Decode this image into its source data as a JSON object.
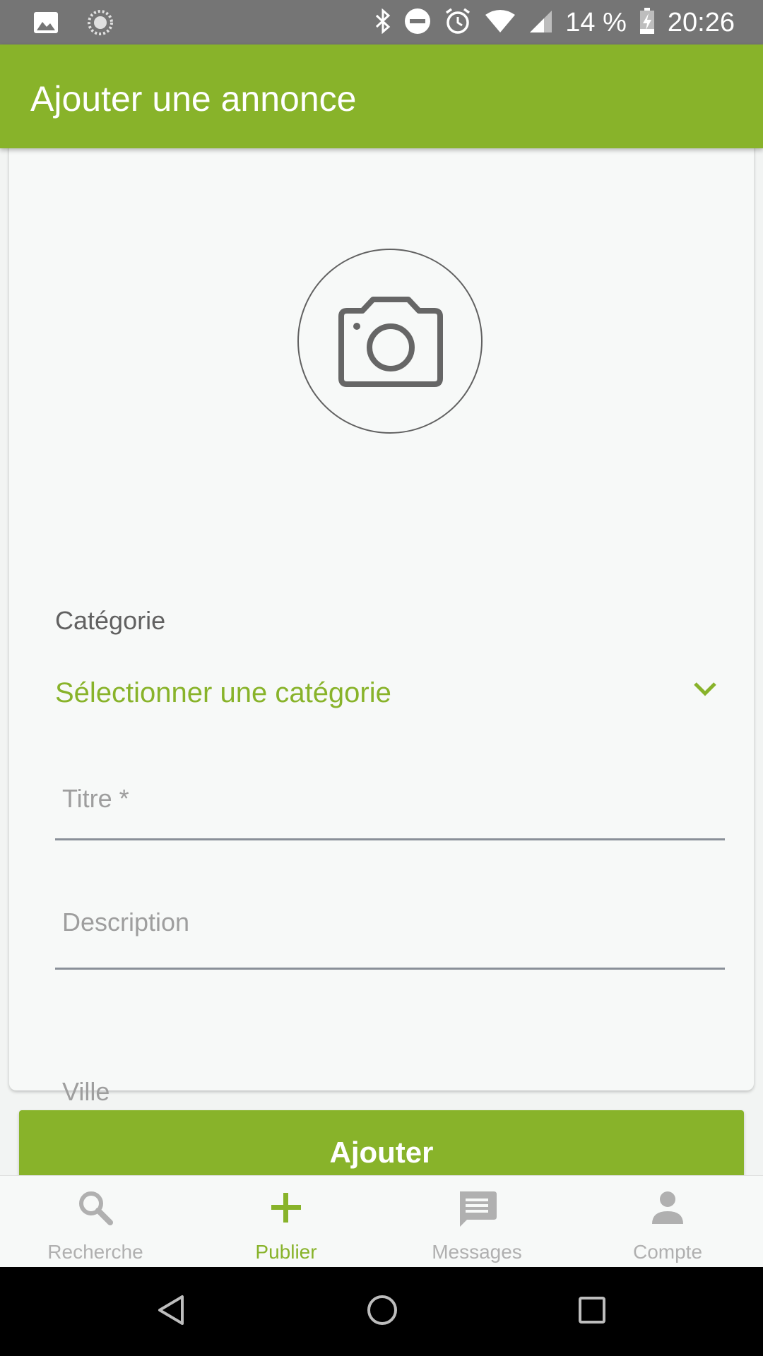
{
  "status_bar": {
    "battery": "14 %",
    "time": "20:26"
  },
  "app_bar": {
    "title": "Ajouter une annonce"
  },
  "form": {
    "category_label": "Catégorie",
    "category_value": "Sélectionner une catégorie",
    "title_placeholder": "Titre *",
    "description_placeholder": "Description",
    "city_placeholder": "Ville"
  },
  "actions": {
    "add_label": "Ajouter"
  },
  "bottom_nav": {
    "items": [
      {
        "label": "Recherche",
        "icon": "search-icon"
      },
      {
        "label": "Publier",
        "icon": "plus-icon"
      },
      {
        "label": "Messages",
        "icon": "message-icon"
      },
      {
        "label": "Compte",
        "icon": "account-icon"
      }
    ],
    "active_index": 1
  },
  "colors": {
    "accent": "#88b32a",
    "status_bar": "#757575"
  }
}
